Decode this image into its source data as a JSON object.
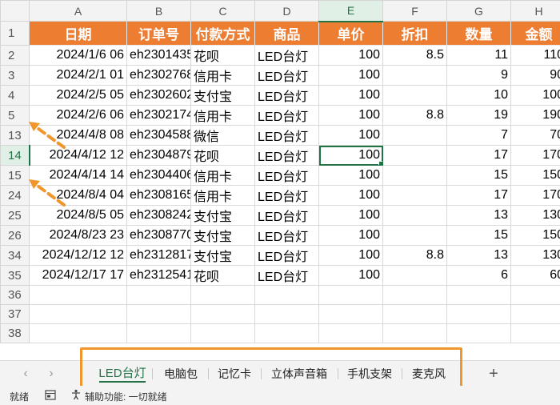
{
  "columns": [
    "A",
    "B",
    "C",
    "D",
    "E",
    "F",
    "G",
    "H"
  ],
  "header_row": {
    "row_num": "1",
    "labels": [
      "日期",
      "订单号",
      "付款方式",
      "商品",
      "单价",
      "折扣",
      "数量",
      "金额"
    ]
  },
  "rows": [
    {
      "n": "2",
      "date": "2024/1/6 06",
      "order": "eh2301435",
      "pay": "花呗",
      "item": "LED台灯",
      "price": "100",
      "disc": "8.5",
      "qty": "11",
      "amt": "110"
    },
    {
      "n": "3",
      "date": "2024/2/1 01",
      "order": "eh2302768",
      "pay": "信用卡",
      "item": "LED台灯",
      "price": "100",
      "disc": "",
      "qty": "9",
      "amt": "90"
    },
    {
      "n": "4",
      "date": "2024/2/5 05",
      "order": "eh2302602",
      "pay": "支付宝",
      "item": "LED台灯",
      "price": "100",
      "disc": "",
      "qty": "10",
      "amt": "100"
    },
    {
      "n": "5",
      "date": "2024/2/6 06",
      "order": "eh2302174",
      "pay": "信用卡",
      "item": "LED台灯",
      "price": "100",
      "disc": "8.8",
      "qty": "19",
      "amt": "190"
    },
    {
      "n": "13",
      "date": "2024/4/8 08",
      "order": "eh2304588",
      "pay": "微信",
      "item": "LED台灯",
      "price": "100",
      "disc": "",
      "qty": "7",
      "amt": "70"
    },
    {
      "n": "14",
      "date": "2024/4/12 12",
      "order": "eh2304879",
      "pay": "花呗",
      "item": "LED台灯",
      "price": "100",
      "disc": "",
      "qty": "17",
      "amt": "170"
    },
    {
      "n": "15",
      "date": "2024/4/14 14",
      "order": "eh2304406",
      "pay": "信用卡",
      "item": "LED台灯",
      "price": "100",
      "disc": "",
      "qty": "15",
      "amt": "150"
    },
    {
      "n": "24",
      "date": "2024/8/4 04",
      "order": "eh2308165",
      "pay": "信用卡",
      "item": "LED台灯",
      "price": "100",
      "disc": "",
      "qty": "17",
      "amt": "170"
    },
    {
      "n": "25",
      "date": "2024/8/5 05",
      "order": "eh2308242",
      "pay": "支付宝",
      "item": "LED台灯",
      "price": "100",
      "disc": "",
      "qty": "13",
      "amt": "130"
    },
    {
      "n": "26",
      "date": "2024/8/23 23",
      "order": "eh2308770",
      "pay": "支付宝",
      "item": "LED台灯",
      "price": "100",
      "disc": "",
      "qty": "15",
      "amt": "150"
    },
    {
      "n": "34",
      "date": "2024/12/12 12",
      "order": "eh2312817",
      "pay": "支付宝",
      "item": "LED台灯",
      "price": "100",
      "disc": "8.8",
      "qty": "13",
      "amt": "130"
    },
    {
      "n": "35",
      "date": "2024/12/17 17",
      "order": "eh2312541",
      "pay": "花呗",
      "item": "LED台灯",
      "price": "100",
      "disc": "",
      "qty": "6",
      "amt": "60"
    }
  ],
  "empty_rows": [
    "36",
    "37",
    "38"
  ],
  "selection": {
    "row": "14",
    "column": "E"
  },
  "sheet_tabs": [
    "LED台灯",
    "电脑包",
    "记忆卡",
    "立体声音箱",
    "手机支架",
    "麦克风"
  ],
  "active_tab": "LED台灯",
  "add_sheet_label": "+",
  "nav": {
    "prev": "‹",
    "next": "›"
  },
  "status": {
    "ready": "就绪",
    "accessibility": "辅助功能: 一切就绪"
  },
  "colors": {
    "header_fill": "#ed7d31",
    "accent": "#217346",
    "annotation": "#f0962a"
  }
}
